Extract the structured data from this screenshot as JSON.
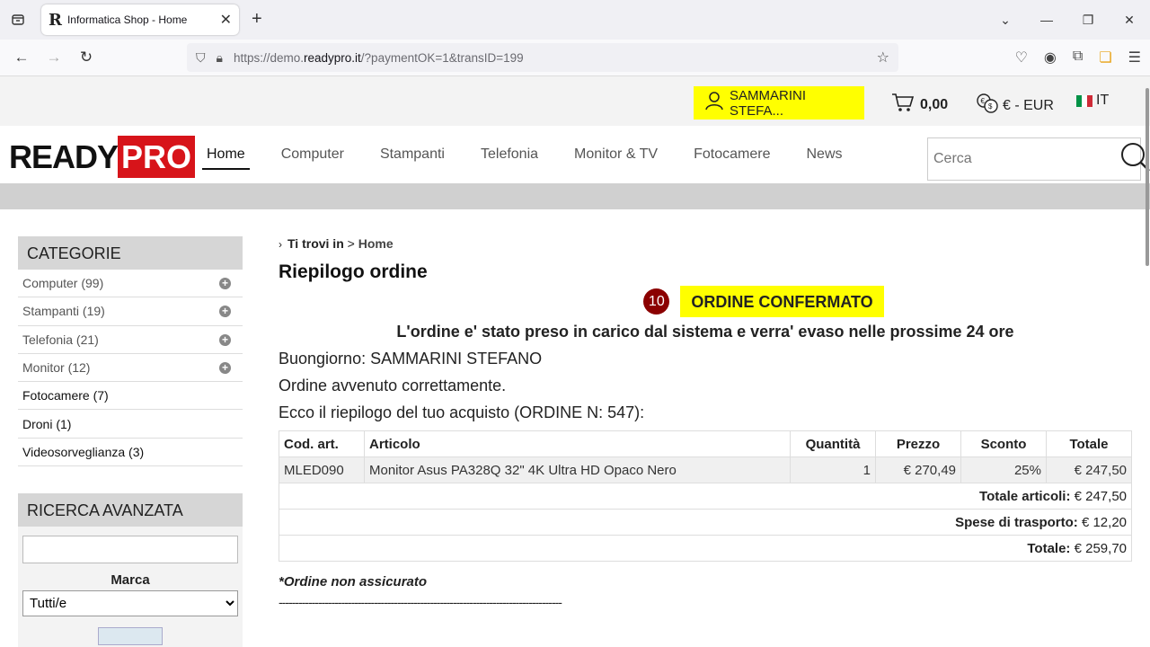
{
  "browser": {
    "tab_title": "Informatica Shop - Home",
    "tab_favicon": "R",
    "url_prefix": "https://demo.",
    "url_domain": "readypro.it",
    "url_suffix": "/?paymentOK=1&transID=199"
  },
  "topbar": {
    "user_label": "SAMMARINI STEFA...",
    "cart_total": "0,00",
    "currency": "€ - EUR",
    "language": "IT"
  },
  "logo": {
    "ready": "READY",
    "pro": "PRO"
  },
  "menu": [
    {
      "label": "Home",
      "active": true
    },
    {
      "label": "Computer"
    },
    {
      "label": "Stampanti"
    },
    {
      "label": "Telefonia"
    },
    {
      "label": "Monitor & TV"
    },
    {
      "label": "Fotocamere"
    },
    {
      "label": "News"
    }
  ],
  "search": {
    "placeholder": "Cerca"
  },
  "sidebar": {
    "title": "CATEGORIE",
    "items": [
      {
        "label": "Computer (99)"
      },
      {
        "label": "Stampanti (19)"
      },
      {
        "label": "Telefonia (21)"
      },
      {
        "label": "Monitor (12)"
      },
      {
        "label": "Fotocamere (7)"
      },
      {
        "label": "Droni (1)"
      },
      {
        "label": "Videosorveglianza (3)"
      }
    ],
    "adv_title": "RICERCA AVANZATA",
    "marca_label": "Marca",
    "marca_value": "Tutti/e"
  },
  "main": {
    "crumb_prefix": "Ti trovi in",
    "crumb_sep": ">",
    "crumb_current": "Home",
    "title": "Riepilogo ordine",
    "badge": "10",
    "confirmed": "ORDINE CONFERMATO",
    "evaso": "L'ordine e' stato preso in carico dal sistema e verra' evaso nelle prossime 24 ore",
    "greeting": "Buongiorno: SAMMARINI STEFANO",
    "ok": "Ordine avvenuto correttamente.",
    "summary": "Ecco il riepilogo del tuo acquisto (ORDINE N: 547):",
    "table": {
      "headers": [
        "Cod. art.",
        "Articolo",
        "Quantità",
        "Prezzo",
        "Sconto",
        "Totale"
      ],
      "row": [
        "MLED090",
        "Monitor Asus PA328Q 32\" 4K Ultra HD Opaco Nero",
        "1",
        "€ 270,49",
        "25%",
        "€ 247,50"
      ],
      "tot_articoli_label": "Totale articoli:",
      "tot_articoli": "€ 247,50",
      "spese_label": "Spese di trasporto:",
      "spese": "€ 12,20",
      "totale_label": "Totale:",
      "totale": "€ 259,70"
    },
    "note": "*Ordine non assicurato",
    "dashes": "--------------------------------------------------------------------------------------"
  }
}
